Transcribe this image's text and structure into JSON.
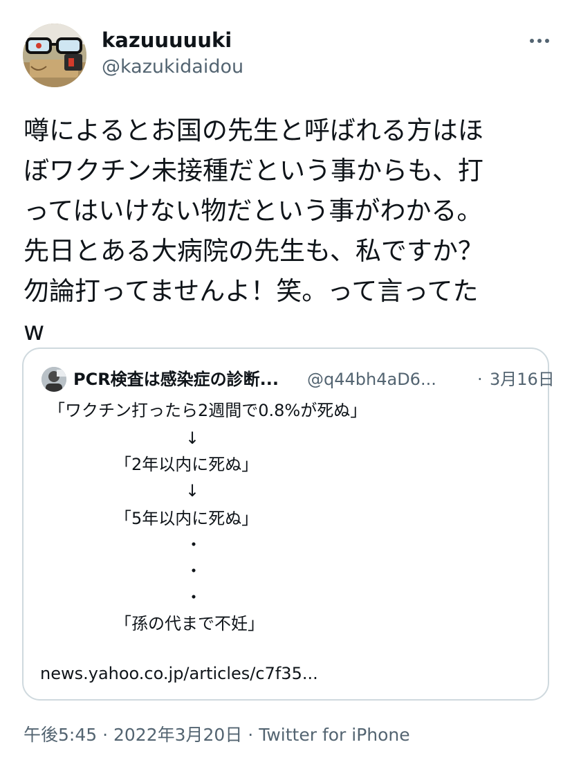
{
  "author": {
    "display_name": "kazuuuuuki",
    "handle": "@kazukidaidou",
    "avatar_icon": "glasses-avatar-icon"
  },
  "more_icon": "more-horizontal-icon",
  "tweet": {
    "lines": [
      "噂によるとお国の先生と呼ばれる方はほ",
      "ぼワクチン未接種だという事からも、打",
      "ってはいけない物だという事がわかる。",
      "先日とある大病院の先生も、私ですか？",
      "勿論打ってませんよ！笑。って言ってた",
      "w"
    ]
  },
  "quote": {
    "author_name": "PCR検査は感染症の診断...",
    "author_handle": "@q44bh4aD6...",
    "separator": "·",
    "date": "3月16日",
    "lines": [
      "「ワクチン打ったら2週間で0.8%が死ぬ」",
      "↓",
      "「2年以内に死ぬ」",
      "↓",
      "「5年以内に死ぬ」",
      "・",
      "・",
      "・",
      "「孫の代まで不妊」"
    ],
    "link": "news.yahoo.co.jp/articles/c7f35..."
  },
  "meta": {
    "time": "午後5:45",
    "date": "2022年3月20日",
    "source": "Twitter for iPhone",
    "separator": "·"
  },
  "colors": {
    "text_primary": "#0f1419",
    "text_secondary": "#536471",
    "card_border": "#cfd9de"
  }
}
